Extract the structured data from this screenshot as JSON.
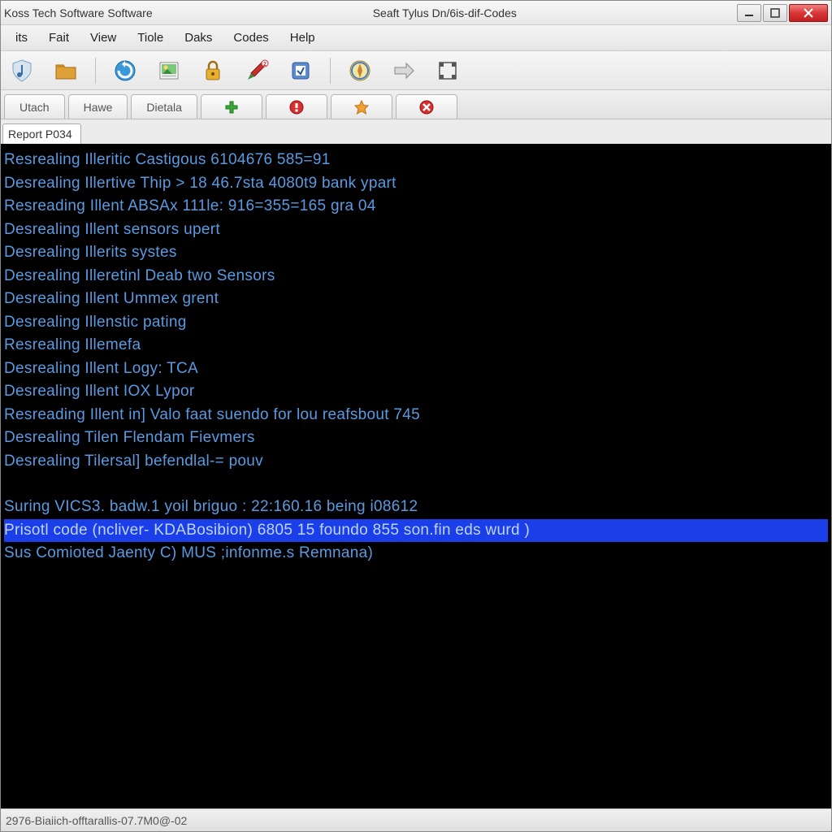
{
  "titlebar": {
    "left": "Koss Tech Software Software",
    "center": "Seaft Tylus Dn/6is-dif-Codes"
  },
  "menubar": {
    "items": [
      "its",
      "Fait",
      "View",
      "Tiole",
      "Daks",
      "Codes",
      "Help"
    ]
  },
  "toolbar": {
    "icons": [
      "shield-music-icon",
      "folder-icon",
      "refresh-circle-icon",
      "picture-icon",
      "lock-icon",
      "brush-icon",
      "stamp-icon",
      "compass-icon",
      "arrow-right-icon",
      "fullscreen-icon"
    ]
  },
  "tabbar": {
    "tabs": [
      {
        "kind": "text",
        "label": "Utach"
      },
      {
        "kind": "text",
        "label": "Hawe"
      },
      {
        "kind": "text",
        "label": "Dietala"
      },
      {
        "kind": "icon",
        "icon": "plus-green-icon"
      },
      {
        "kind": "icon",
        "icon": "error-red-icon"
      },
      {
        "kind": "icon",
        "icon": "star-orange-icon"
      },
      {
        "kind": "icon",
        "icon": "close-red-icon"
      }
    ]
  },
  "subtab": {
    "label": "Report P034"
  },
  "console": {
    "lines": [
      {
        "text": "Resrealing Illeritic Castigous 6104676 585=91",
        "hl": false
      },
      {
        "text": "Desrealing Illertive Thip > 18 46.7sta 4080t9 bank ypart",
        "hl": false
      },
      {
        "text": "Resreading Illent ABSAx 111le: 916=355=165 gra 04",
        "hl": false
      },
      {
        "text": "Desrealing Illent sensors upert",
        "hl": false
      },
      {
        "text": "Desrealing Illerits systes",
        "hl": false
      },
      {
        "text": "Desrealing Illeretinl Deab two Sensors",
        "hl": false
      },
      {
        "text": "Desrealing Illent Ummex grent",
        "hl": false
      },
      {
        "text": "Desrealing Illenstic pating",
        "hl": false
      },
      {
        "text": "Resrealing Illemefa",
        "hl": false
      },
      {
        "text": "Desrealing Illent Logy: TCA",
        "hl": false
      },
      {
        "text": "Desrealing Illent IOX Lypor",
        "hl": false
      },
      {
        "text": "Resreading Illent in] Valo faat suendo for lou reafsbout 745",
        "hl": false
      },
      {
        "text": "Desrealing Tilen Flendam Fievmers",
        "hl": false
      },
      {
        "text": "Desrealing Tilersal] befendlal-= pouv",
        "hl": false
      },
      {
        "text": "",
        "hl": false,
        "blank": true
      },
      {
        "text": "Suring VICS3. badw.1 yoil briguo : 22:160.16 being i08612",
        "hl": false
      },
      {
        "text": "Prisotl code (ncliver- KDABosibion) 6805 15 foundo 855 son.fin eds wurd )",
        "hl": true
      },
      {
        "text": "Sus Comioted Jaenty C) MUS ;infonme.s Remnana)",
        "hl": false
      }
    ]
  },
  "statusbar": {
    "text": "2976-Biaiich-offtarallis-07.7M0@-02"
  }
}
